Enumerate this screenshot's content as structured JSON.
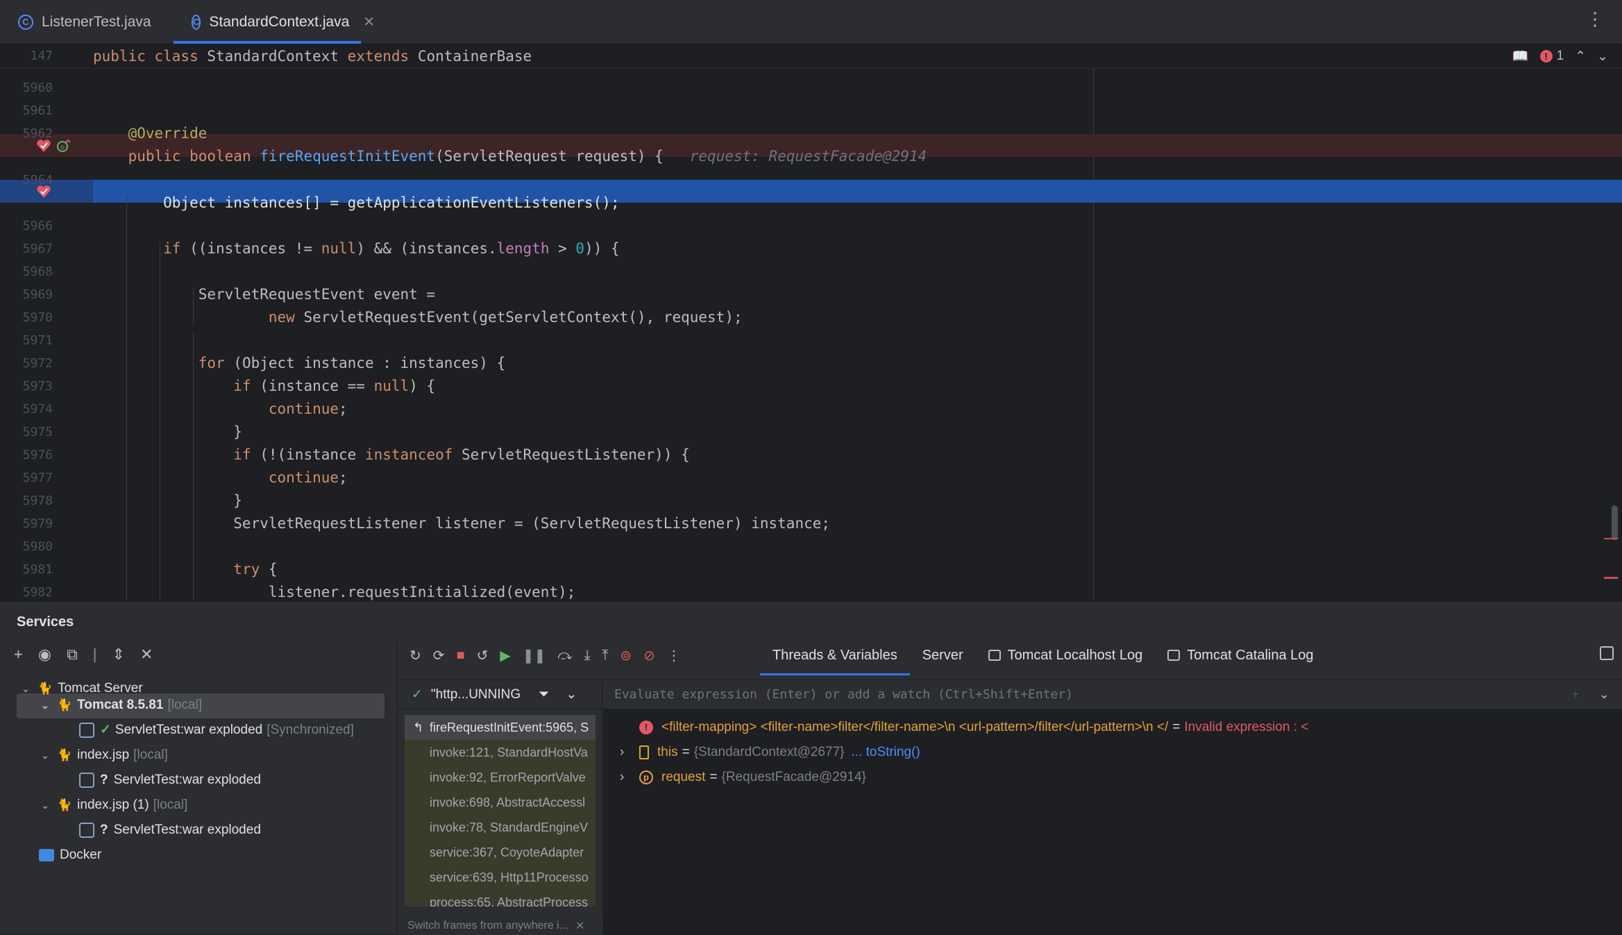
{
  "tabs": [
    {
      "label": "ListenerTest.java",
      "active": false
    },
    {
      "label": "StandardContext.java",
      "active": true
    }
  ],
  "editor": {
    "sticky": {
      "line": "147",
      "code": "public class StandardContext extends ContainerBase"
    },
    "error_count": "1",
    "lines": [
      {
        "n": "5960"
      },
      {
        "n": "5961"
      },
      {
        "n": "5962"
      },
      {
        "n": "",
        "bp": true
      },
      {
        "n": "5964"
      },
      {
        "n": "",
        "current": true
      },
      {
        "n": "5966"
      },
      {
        "n": "5967"
      },
      {
        "n": "5968"
      },
      {
        "n": "5969"
      },
      {
        "n": "5970"
      },
      {
        "n": "5971"
      },
      {
        "n": "5972"
      },
      {
        "n": "5973"
      },
      {
        "n": "5974"
      },
      {
        "n": "5975"
      },
      {
        "n": "5976"
      },
      {
        "n": "5977"
      },
      {
        "n": "5978"
      },
      {
        "n": "5979"
      },
      {
        "n": "5980"
      },
      {
        "n": "5981"
      },
      {
        "n": "5982"
      }
    ],
    "inlay_hint": "request: RequestFacade@2914"
  },
  "services": {
    "title": "Services",
    "tree": [
      {
        "label": "Tomcat Server",
        "suffix": ""
      },
      {
        "label": "Tomcat 8.5.81",
        "suffix": "[local]"
      },
      {
        "label": "ServletTest:war exploded",
        "suffix": "[Synchronized]"
      },
      {
        "label": "index.jsp",
        "suffix": "[local]"
      },
      {
        "label": "ServletTest:war exploded",
        "suffix": ""
      },
      {
        "label": "index.jsp (1)",
        "suffix": "[local]"
      },
      {
        "label": "ServletTest:war exploded",
        "suffix": ""
      },
      {
        "label": "Docker",
        "suffix": ""
      }
    ]
  },
  "debugger": {
    "tabs": [
      "Threads & Variables",
      "Server",
      "Tomcat Localhost Log",
      "Tomcat Catalina Log"
    ],
    "thread": "\"http...UNNING",
    "frames": [
      "fireRequestInitEvent:5965, S",
      "invoke:121, StandardHostVa",
      "invoke:92, ErrorReportValve",
      "invoke:698, AbstractAccessl",
      "invoke:78, StandardEngineV",
      "service:367, CoyoteAdapter",
      "service:639, Http11Processo",
      "process:65, AbstractProcess"
    ],
    "frames_hint": "Switch frames from anywhere i...",
    "eval_placeholder": "Evaluate expression (Enter) or add a watch (Ctrl+Shift+Enter)",
    "watch": {
      "expr": "<filter-mapping>  <filter-name>filter</filter-name>\\n        <url-pattern>/filter</url-pattern>\\n     </",
      "eq": "=",
      "error": "Invalid expression : <"
    },
    "vars": [
      {
        "name": "this",
        "value": "{StandardContext@2677}",
        "link": "... toString()"
      },
      {
        "name": "request",
        "value": "{RequestFacade@2914}",
        "link": ""
      }
    ]
  }
}
